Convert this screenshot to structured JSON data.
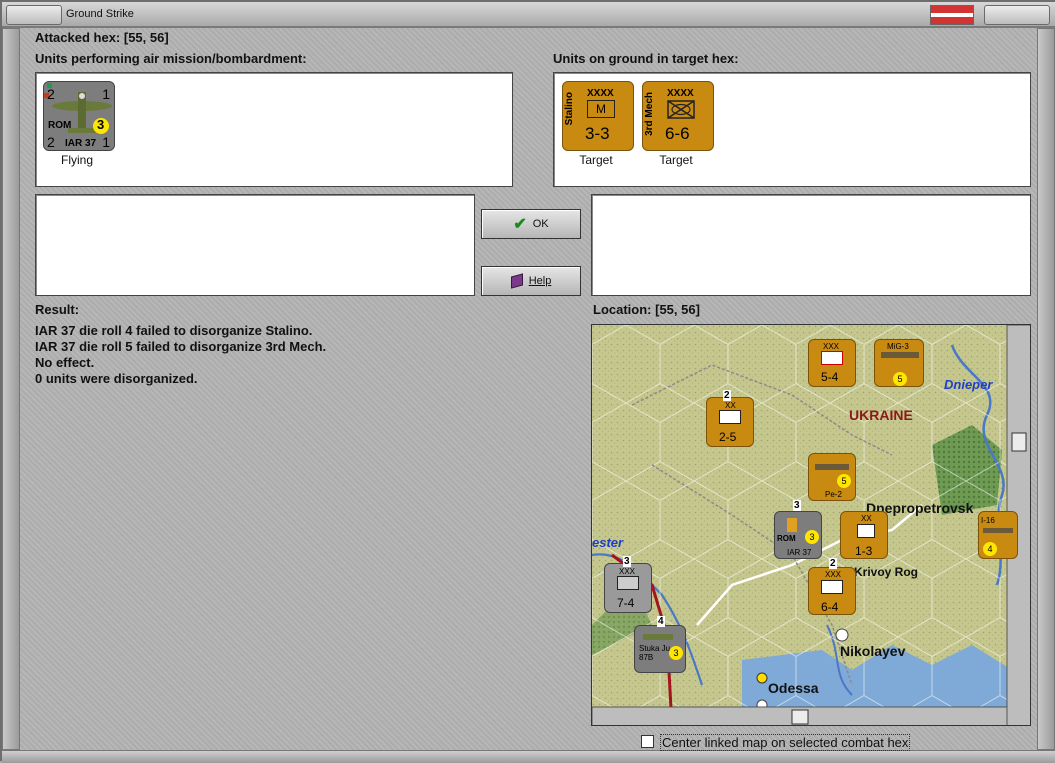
{
  "window": {
    "title": "Ground Strike"
  },
  "attacked_hex": {
    "label": "Attacked hex:",
    "value": "[55, 56]"
  },
  "air_units": {
    "label": "Units performing air mission/bombardment:",
    "units": [
      {
        "nation": "ROM",
        "name": "IAR 37",
        "top_left": "2",
        "top_right": "1",
        "bottom_left": "2",
        "bottom_right": "1",
        "badge": "3",
        "status": "Flying"
      }
    ]
  },
  "ground_units": {
    "label": "Units on ground in target hex:",
    "units": [
      {
        "name": "Stalino",
        "size": "XXXX",
        "symbol": "M",
        "strength": "3-3",
        "status": "Target"
      },
      {
        "name": "3rd Mech",
        "size": "XXXX",
        "symbol": "",
        "strength": "6-6",
        "status": "Target"
      }
    ]
  },
  "buttons": {
    "ok": "OK",
    "help": "Help"
  },
  "result": {
    "label": "Result:",
    "lines": [
      "IAR 37 die roll 4 failed to disorganize Stalino.",
      "IAR 37 die roll 5 failed to disorganize 3rd Mech.",
      "No effect.",
      "0 units were disorganized."
    ]
  },
  "location": {
    "label": "Location:",
    "value": "[55, 56]"
  },
  "map": {
    "place_labels": [
      "Dnieper",
      "UKRAINE",
      "Dnepropetrovsk",
      "Krivoy Rog",
      "Nikolayev",
      "Odessa",
      "ester"
    ],
    "counters": [
      {
        "size": "XXX",
        "strength": "5-4",
        "color": "orange"
      },
      {
        "name": "MiG-3",
        "badge": "5",
        "color": "orange"
      },
      {
        "size": "XX",
        "strength": "2-5",
        "color": "orange",
        "stack": "2"
      },
      {
        "name": "Pe-2",
        "badge": "5",
        "color": "orange"
      },
      {
        "name": "IAR 37",
        "nation": "ROM",
        "badge": "3",
        "color": "gray",
        "stack": "3"
      },
      {
        "size": "XX",
        "strength": "1-3",
        "color": "orange"
      },
      {
        "name": "I-16",
        "badge": "4",
        "color": "orange"
      },
      {
        "size": "XXX",
        "strength": "7-4",
        "color": "gray",
        "stack": "3"
      },
      {
        "size": "XXX",
        "strength": "6-4",
        "color": "orange",
        "stack": "2"
      },
      {
        "name": "Stuka Ju 87B",
        "badge": "3",
        "color": "gray",
        "stack": "4"
      }
    ],
    "colors": {
      "terrain": "#c2c48a",
      "water": "#7fa9d6",
      "hex_grid": "#ffffff"
    }
  },
  "options": {
    "center_linked_map": "Center linked map on selected combat hex"
  }
}
